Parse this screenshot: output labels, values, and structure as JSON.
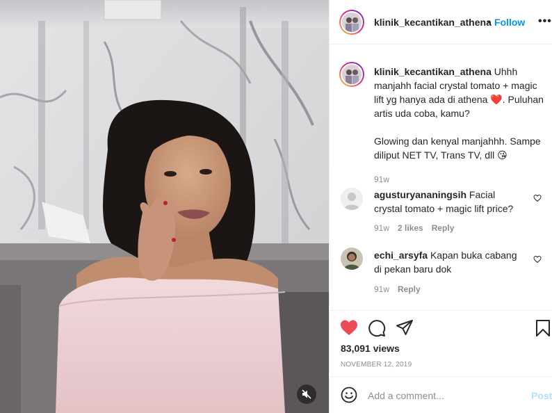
{
  "post": {
    "username": "klinik_kecantikan_athena",
    "follow_label": "Follow",
    "separator": "•",
    "more_label": "•••"
  },
  "caption": {
    "username": "klinik_kecantikan_athena",
    "text_line1": " Uhhh manjahh facial crystal tomato + magic lift yg hanya ada di athena ",
    "emoji1": "❤️",
    "text_line2": ". Puluhan artis uda coba, kamu?",
    "text_para2": "Glowing dan kenyal manjahhh. Sampe diliput NET TV, Trans TV, dll ",
    "emoji2": "😘",
    "time": "91w"
  },
  "comments": [
    {
      "username": "agusturyananingsih",
      "text": " Facial crystal tomato + magic lift price?",
      "time": "91w",
      "likes": "2 likes",
      "reply_label": "Reply"
    },
    {
      "username": "echi_arsyfa",
      "text": " Kapan buka cabang di pekan baru dok",
      "time": "91w",
      "reply_label": "Reply"
    }
  ],
  "stats": {
    "views": "83,091 views",
    "date": "NOVEMBER 12, 2019"
  },
  "add_comment": {
    "placeholder": "Add a comment...",
    "post_label": "Post"
  },
  "icons": {
    "like": "heart-filled-icon",
    "comment": "comment-icon",
    "share": "share-icon",
    "save": "bookmark-icon",
    "emoji": "emoji-icon",
    "mute": "muted-speaker-icon",
    "more": "more-options-icon"
  },
  "colors": {
    "accent": "#0095f6",
    "liked": "#ed4956",
    "muted_text": "#8e8e8e",
    "post_disabled": "#b2dffc"
  }
}
